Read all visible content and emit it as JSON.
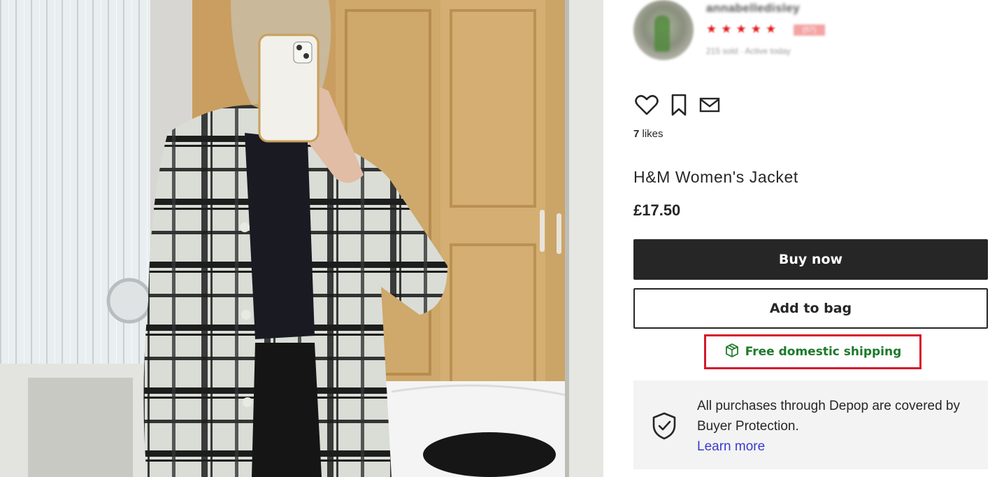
{
  "seller": {
    "username": "annabelledisley",
    "rating_stars": 5,
    "review_count": "(57)",
    "meta": "215 sold · Active today"
  },
  "social": {
    "likes_count": "7",
    "likes_label": " likes"
  },
  "product": {
    "title": "H&M Women's Jacket",
    "price": "£17.50"
  },
  "buttons": {
    "buy_now": "Buy now",
    "add_to_bag": "Add to bag"
  },
  "shipping": {
    "label": "Free domestic shipping"
  },
  "protection": {
    "text": "All purchases through Depop are covered by Buyer Protection.",
    "link": "Learn more"
  },
  "icons": {
    "like": "heart-icon",
    "save": "bookmark-icon",
    "message": "mail-icon",
    "shipping": "package-icon",
    "protection": "shield-check-icon"
  },
  "colors": {
    "primary_button": "#262626",
    "shipping_text": "#1c7a2b",
    "highlight_box": "#d6182a",
    "rating_star": "#e21a1a",
    "link": "#3a3ad1",
    "protection_bg": "#f3f3f3"
  }
}
